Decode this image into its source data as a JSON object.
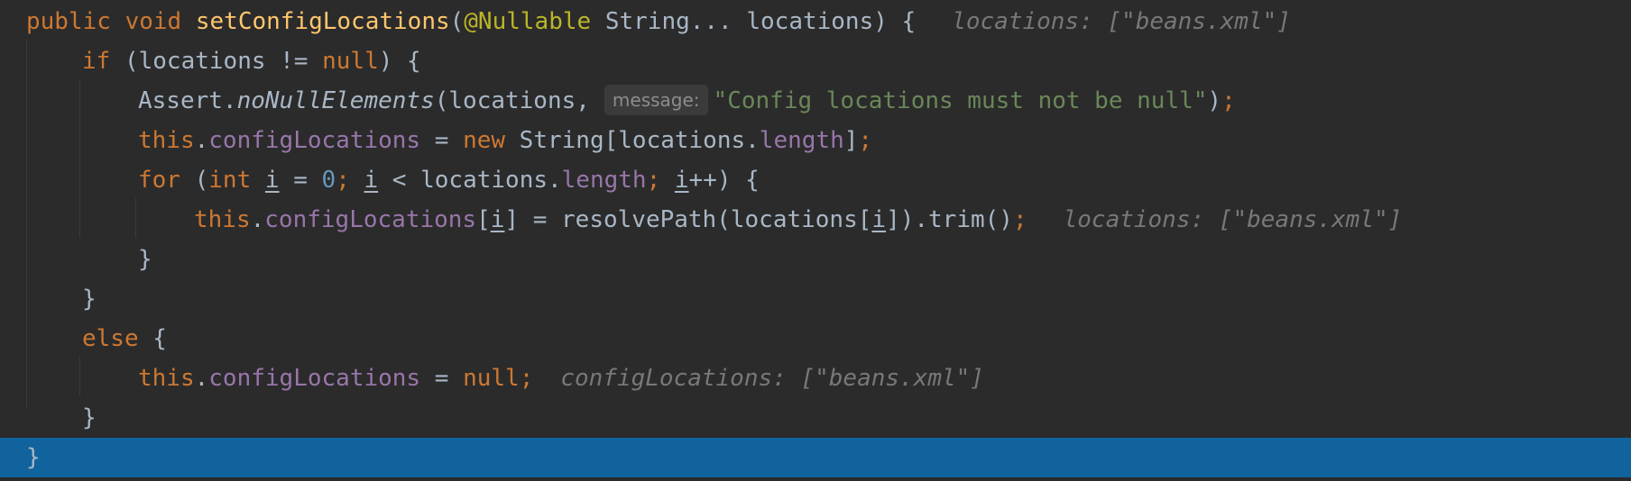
{
  "editor": {
    "line1": {
      "public": "public",
      "void": "void",
      "method": "setConfigLocations",
      "paren_open": "(",
      "annotation": "@Nullable",
      "params": " String... locations) {",
      "hint": "locations: [\"beans.xml\"]"
    },
    "line2": {
      "kw_if": "if",
      "cond": " (locations != ",
      "null": "null",
      "tail": ") {"
    },
    "line3": {
      "call": "Assert.",
      "method": "noNullElements",
      "args": "(locations,",
      "param_hint": "message:",
      "string": "\"Config locations must not be null\"",
      "tail": ")",
      "semi": ";"
    },
    "line4": {
      "this": "this",
      "dot": ".",
      "field": "configLocations",
      "assign": " = ",
      "new": "new",
      "type": " String[locations.",
      "length": "length",
      "tail": "]",
      "semi": ";"
    },
    "line5": {
      "for": "for",
      "open": " (",
      "int": "int",
      "i1": "i",
      "eq": " = ",
      "zero": "0",
      "semi1": ";",
      "i2": "i",
      "lt": " < locations.",
      "length": "length",
      "semi2": ";",
      "i3": "i",
      "tail": "++) {"
    },
    "line6": {
      "this": "this",
      "dot": ".",
      "field": "configLocations",
      "bracket": "[",
      "i1": "i",
      "mid": "] = resolvePath(locations[",
      "i2": "i",
      "tail": "]).trim()",
      "semi": ";",
      "hint": "locations: [\"beans.xml\"]"
    },
    "line7": {
      "brace": "}"
    },
    "line8": {
      "brace": "}"
    },
    "line9": {
      "else": "else",
      "tail": " {"
    },
    "line10": {
      "this": "this",
      "dot": ".",
      "field": "configLocations",
      "assign": " = ",
      "null": "null",
      "semi": ";",
      "hint": "configLocations: [\"beans.xml\"]"
    },
    "line11": {
      "brace": "}"
    },
    "line12": {
      "brace": "}"
    }
  },
  "colors": {
    "background": "#2b2b2b",
    "keyword": "#cc7832",
    "method": "#ffc66d",
    "annotation": "#bbb529",
    "number": "#6897bb",
    "string": "#6a8759",
    "field": "#9876aa",
    "hint": "#787878",
    "current_line": "#11639d"
  }
}
